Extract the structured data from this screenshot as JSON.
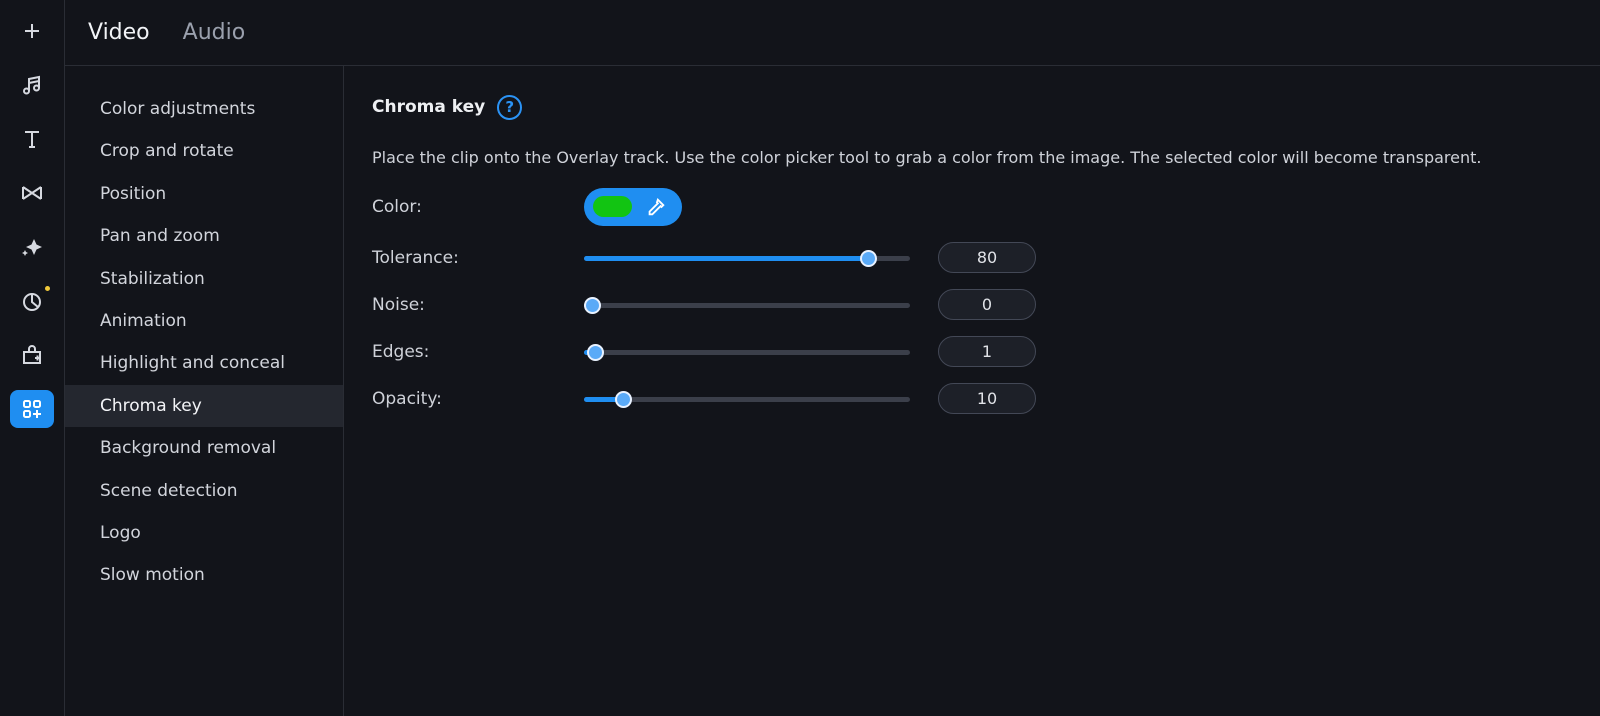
{
  "rail": {
    "items": [
      {
        "icon": "plus-icon",
        "active": false
      },
      {
        "icon": "music-icon",
        "active": false
      },
      {
        "icon": "text-icon",
        "active": false
      },
      {
        "icon": "transitions-icon",
        "active": false
      },
      {
        "icon": "sparkle-icon",
        "active": false
      },
      {
        "icon": "stickers-icon",
        "active": false,
        "dot_color": "#f0c93a"
      },
      {
        "icon": "store-icon",
        "active": false
      },
      {
        "icon": "more-tools-icon",
        "active": true
      }
    ]
  },
  "tabs": [
    {
      "label": "Video",
      "active": true
    },
    {
      "label": "Audio",
      "active": false
    }
  ],
  "settings": {
    "items": [
      "Color adjustments",
      "Crop and rotate",
      "Position",
      "Pan and zoom",
      "Stabilization",
      "Animation",
      "Highlight and conceal",
      "Chroma key",
      "Background removal",
      "Scene detection",
      "Logo",
      "Slow motion"
    ],
    "active": "Chroma key"
  },
  "panel": {
    "title": "Chroma key",
    "help_icon": "?",
    "description": "Place the clip onto the Overlay track. Use the color picker tool to grab a color from the image. The selected color will become transparent.",
    "color_label": "Color:",
    "color_value": "#12c412",
    "sliders": [
      {
        "label": "Tolerance:",
        "value": "80",
        "fraction": 0.87
      },
      {
        "label": "Noise:",
        "value": "0",
        "fraction": 0.025
      },
      {
        "label": "Edges:",
        "value": "1",
        "fraction": 0.035
      },
      {
        "label": "Opacity:",
        "value": "10",
        "fraction": 0.12
      }
    ]
  },
  "colors": {
    "accent": "#1f8ef1",
    "background": "#12141a"
  }
}
